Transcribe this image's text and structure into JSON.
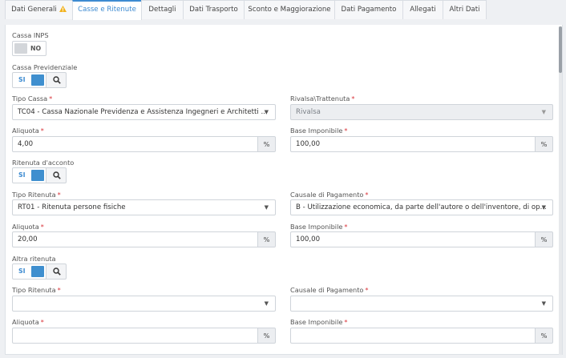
{
  "tabs": [
    {
      "label": "Dati Generali"
    },
    {
      "label": "Casse e Ritenute"
    },
    {
      "label": "Dettagli"
    },
    {
      "label": "Dati Trasporto"
    },
    {
      "label": "Sconto e Maggiorazione"
    },
    {
      "label": "Dati Pagamento"
    },
    {
      "label": "Allegati"
    },
    {
      "label": "Altri Dati"
    }
  ],
  "active_tab": "Casse e Ritenute",
  "colors": {
    "accent": "#3d8bd1",
    "required": "#d9343a",
    "warning": "#f1b21e"
  },
  "required_mark": "*",
  "percent_symbol": "%",
  "cassa_inps": {
    "label": "Cassa INPS",
    "toggle": "NO"
  },
  "cassa_previdenziale": {
    "label": "Cassa Previdenziale",
    "toggle": "SI"
  },
  "tipo_cassa": {
    "label": "Tipo Cassa",
    "value": "TC04 - Cassa Nazionale Previdenza e Assistenza Ingegneri e Architetti ..."
  },
  "rivalsa_trattenuta": {
    "label": "Rivalsa\\Trattenuta",
    "value": "Rivalsa"
  },
  "cassa_aliquota": {
    "label": "Aliquota",
    "value": "4,00"
  },
  "cassa_base_imponibile": {
    "label": "Base Imponibile",
    "value": "100,00"
  },
  "ritenuta_acconto": {
    "label": "Ritenuta d'acconto",
    "toggle": "SI"
  },
  "tipo_ritenuta_1": {
    "label": "Tipo Ritenuta",
    "value": "RT01 - Ritenuta persone fisiche"
  },
  "causale_pagamento_1": {
    "label": "Causale di Pagamento",
    "value": "B - Utilizzazione economica, da parte dell'autore o dell'inventore, di op..."
  },
  "ritenuta_aliquota_1": {
    "label": "Aliquota",
    "value": "20,00"
  },
  "ritenuta_base_imponibile_1": {
    "label": "Base Imponibile",
    "value": "100,00"
  },
  "altra_ritenuta": {
    "label": "Altra ritenuta",
    "toggle": "SI"
  },
  "tipo_ritenuta_2": {
    "label": "Tipo Ritenuta",
    "value": ""
  },
  "causale_pagamento_2": {
    "label": "Causale di Pagamento",
    "value": ""
  },
  "ritenuta_aliquota_2": {
    "label": "Aliquota",
    "value": ""
  },
  "ritenuta_base_imponibile_2": {
    "label": "Base Imponibile",
    "value": ""
  }
}
